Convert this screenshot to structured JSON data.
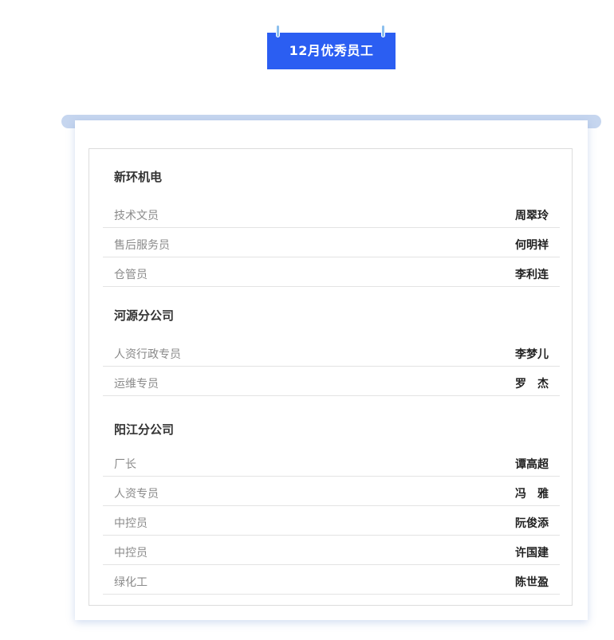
{
  "title": "12月优秀员工",
  "colors": {
    "title_bg": "#2b5ef2",
    "ring": "#8cc0ee",
    "roller": "#c6d6ef"
  },
  "sections": [
    {
      "name": "新环机电",
      "rows": [
        {
          "role": "技术文员",
          "name": "周翠玲"
        },
        {
          "role": "售后服务员",
          "name": "何明祥"
        },
        {
          "role": "仓管员",
          "name": "李利连"
        }
      ]
    },
    {
      "name": "河源分公司",
      "rows": [
        {
          "role": "人资行政专员",
          "name": "李梦儿"
        },
        {
          "role": "运维专员",
          "name": "罗　杰"
        }
      ]
    },
    {
      "name": "阳江分公司",
      "rows": [
        {
          "role": "厂长",
          "name": "谭高超"
        },
        {
          "role": "人资专员",
          "name": "冯　雅"
        },
        {
          "role": "中控员",
          "name": "阮俊添"
        },
        {
          "role": "中控员",
          "name": "许国建"
        },
        {
          "role": "绿化工",
          "name": "陈世盈"
        }
      ]
    }
  ]
}
